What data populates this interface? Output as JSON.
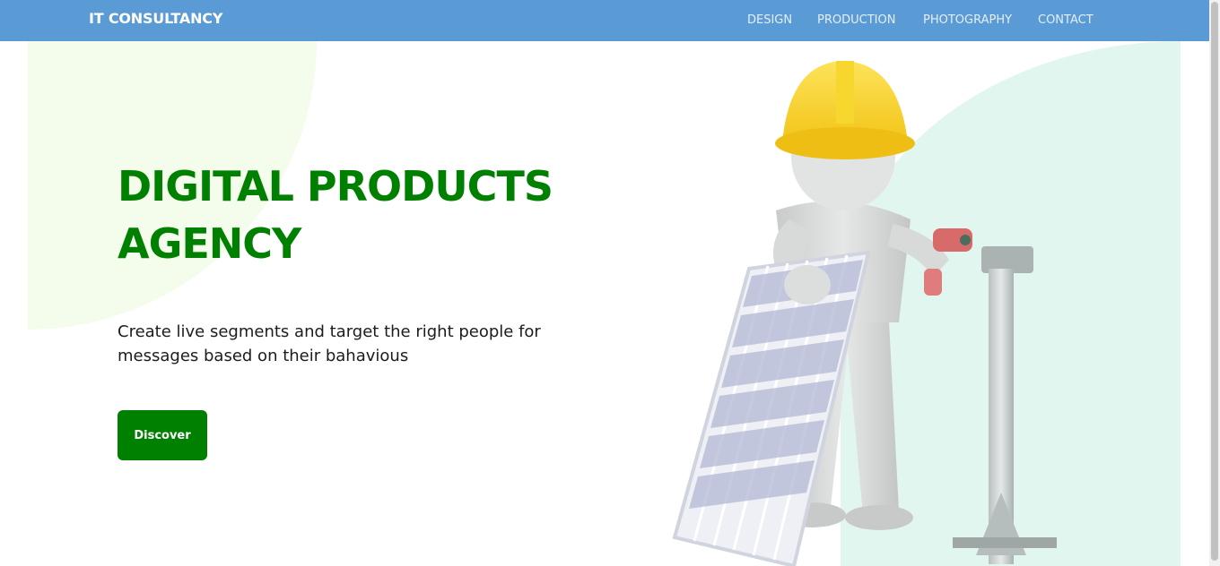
{
  "header": {
    "brand": "IT CONSULTANCY",
    "nav": [
      {
        "label": "DESIGN"
      },
      {
        "label": "PRODUCTION"
      },
      {
        "label": "PHOTOGRAPHY"
      },
      {
        "label": "CONTACT"
      }
    ]
  },
  "hero": {
    "title": "DIGITAL PRODUCTS AGENCY",
    "subtitle": "Create live segments and target the right people for messages based on their bahavious",
    "cta_label": "Discover"
  },
  "colors": {
    "navbar": "#5b9bd5",
    "accent_green": "#008000",
    "left_blob": "#f4fdec",
    "right_blob": "#e1f6ee"
  },
  "illustration": {
    "icon": "worker-solar-panel-illustration"
  }
}
